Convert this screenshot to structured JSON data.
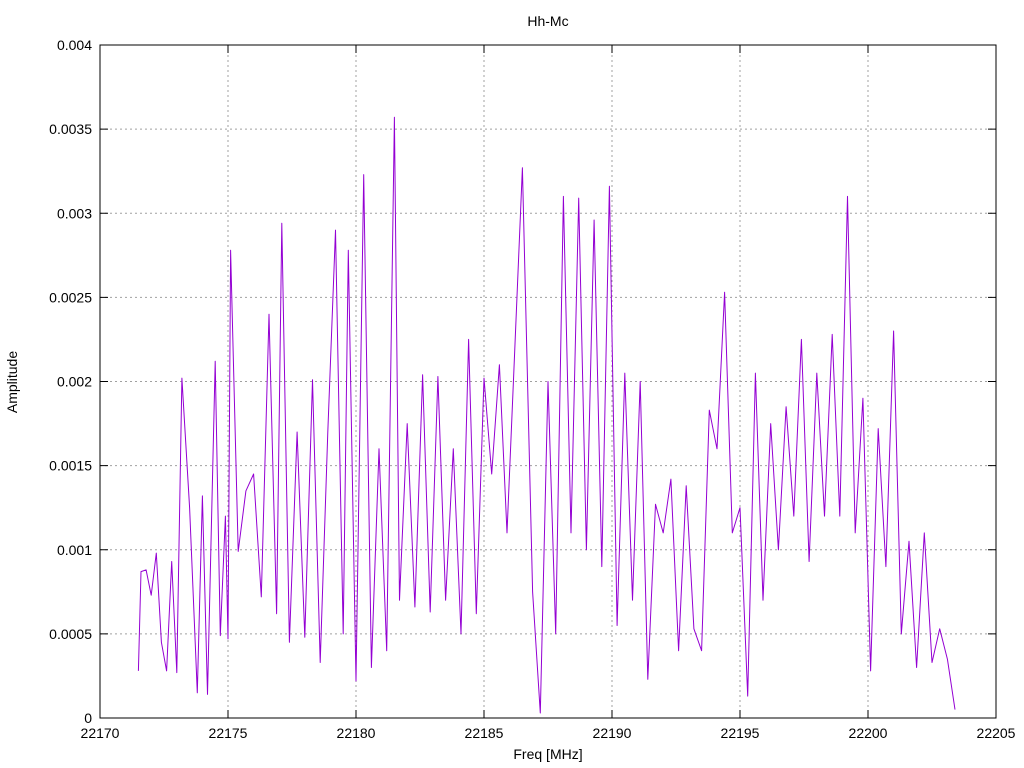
{
  "chart_data": {
    "type": "line",
    "title": "Hh-Mc",
    "xlabel": "Freq [MHz]",
    "ylabel": "Amplitude",
    "xlim": [
      22170,
      22205
    ],
    "ylim": [
      0,
      0.004
    ],
    "xticks": [
      "22170",
      "22175",
      "22180",
      "22185",
      "22190",
      "22195",
      "22200",
      "22205"
    ],
    "yticks": [
      "0",
      "0.0005",
      "0.001",
      "0.0015",
      "0.002",
      "0.0025",
      "0.003",
      "0.0035",
      "0.004"
    ],
    "grid": true,
    "legend": "none",
    "series": [
      {
        "color": "#9400d3",
        "x": [
          22171.5,
          22171.6,
          22171.8,
          22172.0,
          22172.2,
          22172.4,
          22172.6,
          22172.8,
          22173.0,
          22173.2,
          22173.5,
          22173.8,
          22174.0,
          22174.2,
          22174.5,
          22174.7,
          22174.9,
          22175.0,
          22175.1,
          22175.4,
          22175.7,
          22176.0,
          22176.3,
          22176.6,
          22176.9,
          22177.1,
          22177.4,
          22177.7,
          22178.0,
          22178.3,
          22178.6,
          22178.9,
          22179.2,
          22179.5,
          22179.7,
          22180.0,
          22180.3,
          22180.6,
          22180.9,
          22181.2,
          22181.5,
          22181.7,
          22182.0,
          22182.3,
          22182.6,
          22182.9,
          22183.2,
          22183.5,
          22183.8,
          22184.1,
          22184.4,
          22184.7,
          22185.0,
          22185.3,
          22185.6,
          22185.9,
          22186.2,
          22186.5,
          22186.9,
          22187.2,
          22187.5,
          22187.8,
          22188.1,
          22188.4,
          22188.7,
          22189.0,
          22189.3,
          22189.6,
          22189.9,
          22190.2,
          22190.5,
          22190.8,
          22191.1,
          22191.4,
          22191.7,
          22192.0,
          22192.3,
          22192.6,
          22192.9,
          22193.2,
          22193.5,
          22193.8,
          22194.1,
          22194.4,
          22194.7,
          22195.0,
          22195.3,
          22195.6,
          22195.9,
          22196.2,
          22196.5,
          22196.8,
          22197.1,
          22197.4,
          22197.7,
          22198.0,
          22198.3,
          22198.6,
          22198.9,
          22199.2,
          22199.5,
          22199.8,
          22200.1,
          22200.4,
          22200.7,
          22201.0,
          22201.3,
          22201.6,
          22201.9,
          22202.2,
          22202.5,
          22202.8,
          22203.1,
          22203.4
        ],
        "y": [
          0.00028,
          0.00087,
          0.00088,
          0.00073,
          0.00098,
          0.00045,
          0.00028,
          0.00093,
          0.00027,
          0.00202,
          0.00125,
          0.00015,
          0.00132,
          0.00014,
          0.00212,
          0.00049,
          0.0012,
          0.00047,
          0.00278,
          0.00099,
          0.00135,
          0.00145,
          0.00072,
          0.0024,
          0.00062,
          0.00294,
          0.00045,
          0.0017,
          0.00048,
          0.00201,
          0.00033,
          0.0017,
          0.0029,
          0.0005,
          0.00278,
          0.00022,
          0.00323,
          0.0003,
          0.0016,
          0.0004,
          0.00357,
          0.0007,
          0.00175,
          0.00066,
          0.00204,
          0.00063,
          0.00203,
          0.0007,
          0.0016,
          0.0005,
          0.00225,
          0.00062,
          0.00202,
          0.00145,
          0.0021,
          0.0011,
          0.00218,
          0.00327,
          0.00075,
          3e-05,
          0.002,
          0.0005,
          0.0031,
          0.0011,
          0.00309,
          0.001,
          0.00296,
          0.0009,
          0.00316,
          0.00055,
          0.00205,
          0.0007,
          0.002,
          0.00023,
          0.00127,
          0.0011,
          0.00142,
          0.0004,
          0.00138,
          0.00053,
          0.0004,
          0.00183,
          0.0016,
          0.00253,
          0.0011,
          0.00125,
          0.00013,
          0.00205,
          0.0007,
          0.00175,
          0.001,
          0.00185,
          0.0012,
          0.00225,
          0.00093,
          0.00205,
          0.0012,
          0.00228,
          0.0012,
          0.0031,
          0.0011,
          0.0019,
          0.00028,
          0.00172,
          0.0009,
          0.0023,
          0.0005,
          0.00105,
          0.0003,
          0.0011,
          0.00033,
          0.00053,
          0.00035,
          5e-05
        ]
      }
    ]
  }
}
